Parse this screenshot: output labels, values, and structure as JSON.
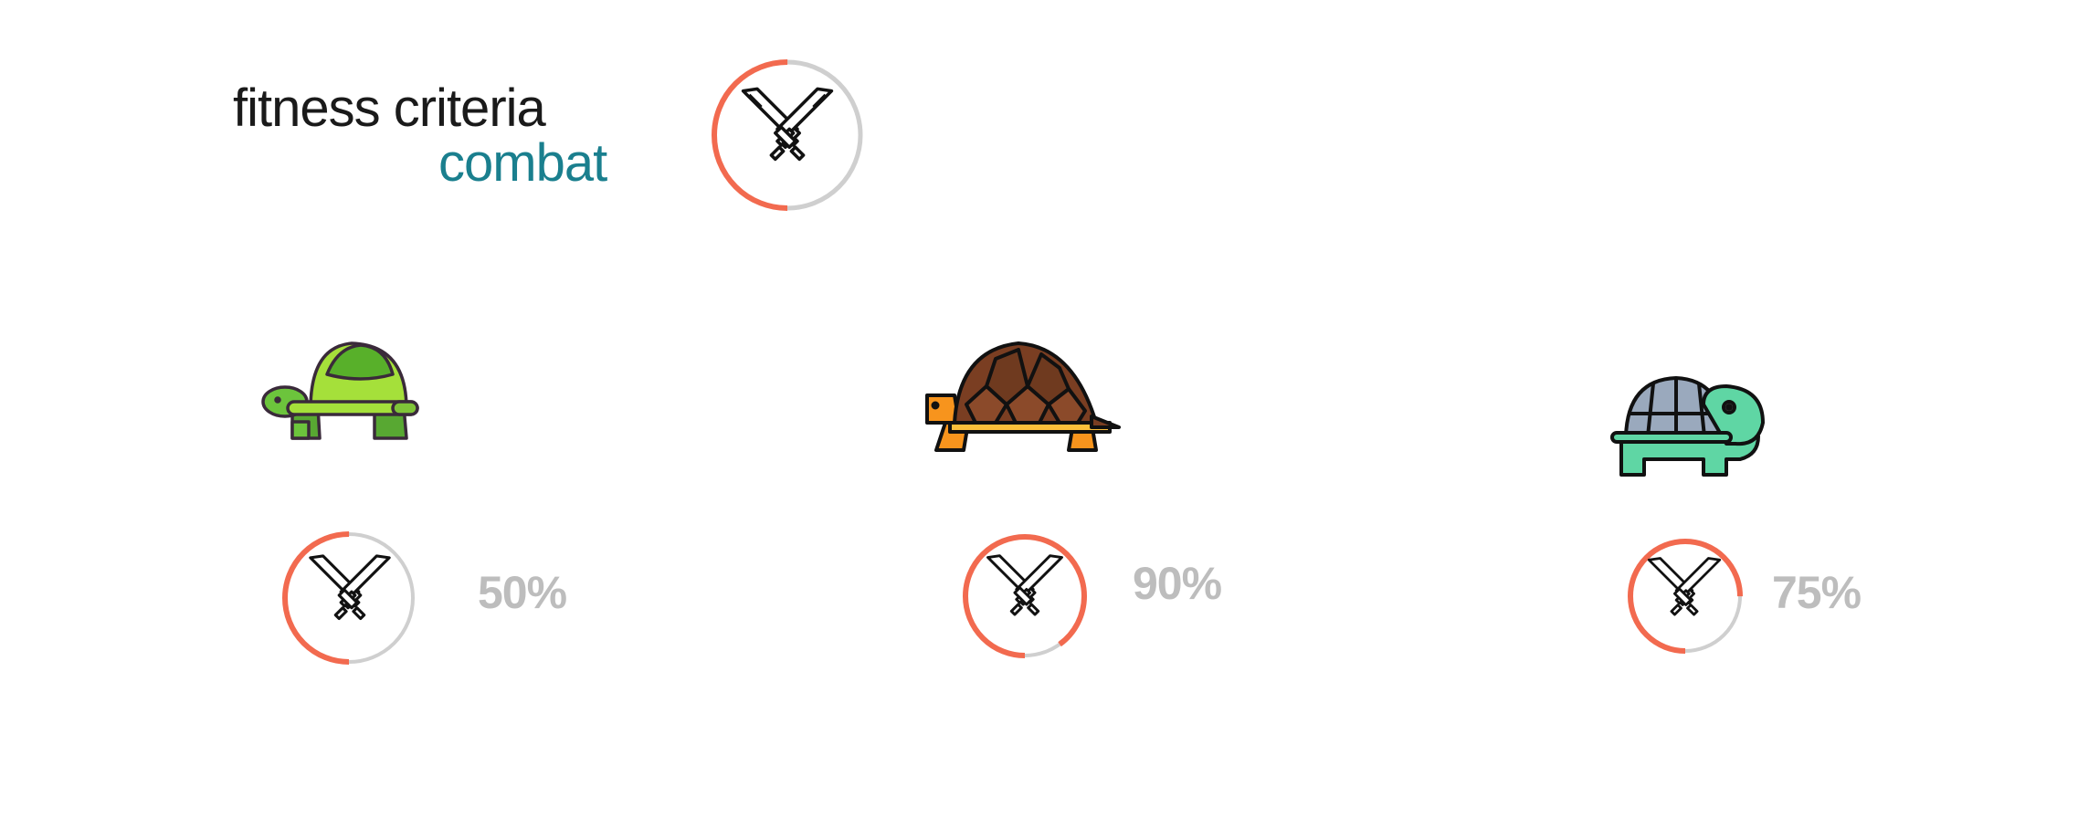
{
  "header": {
    "title": "fitness criteria",
    "subtitle": "combat",
    "accent_color": "#1a7f8e"
  },
  "criterion_icon": {
    "icon": "crossed-swords-icon",
    "progress": 0.5
  },
  "ring_colors": {
    "progress": "#f26a4f",
    "track": "#cfcfcf"
  },
  "candidates": [
    {
      "name_icon": "green-turtle-icon",
      "percent_label": "50%",
      "progress": 0.5
    },
    {
      "name_icon": "brown-tortoise-icon",
      "percent_label": "90%",
      "progress": 0.9
    },
    {
      "name_icon": "teal-turtle-icon",
      "percent_label": "75%",
      "progress": 0.75
    }
  ]
}
